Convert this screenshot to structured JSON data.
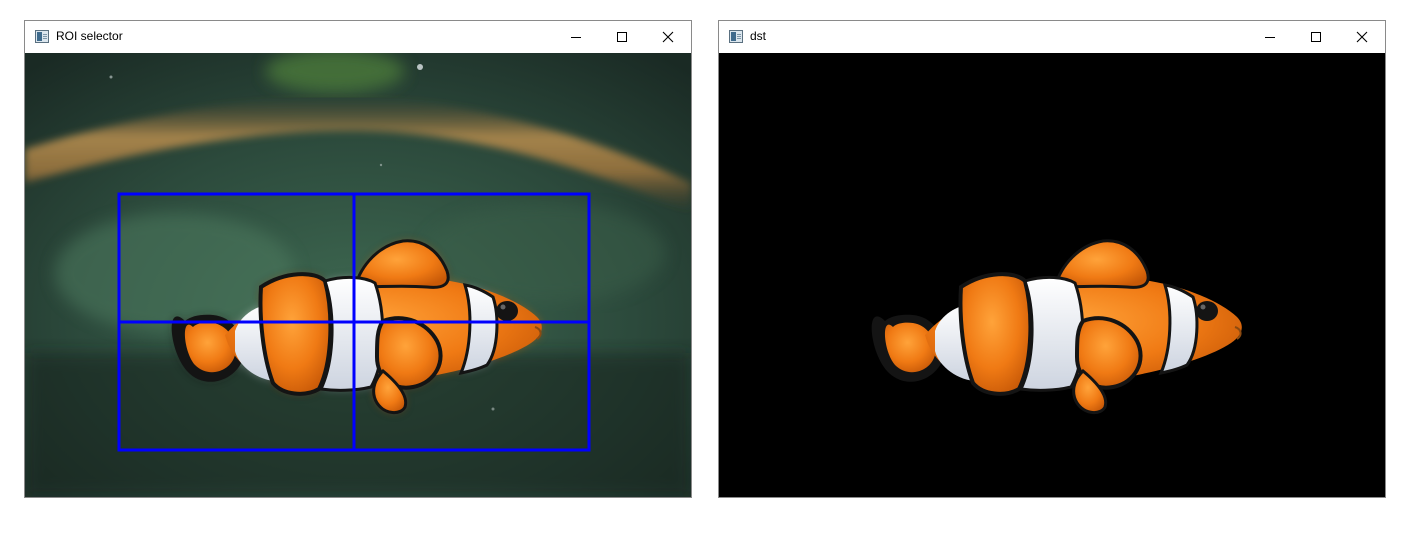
{
  "windows": [
    {
      "title": "ROI selector",
      "controls": {
        "minimize": "–",
        "maximize": "□",
        "close": "×"
      }
    },
    {
      "title": "dst",
      "controls": {
        "minimize": "–",
        "maximize": "□",
        "close": "×"
      }
    }
  ],
  "roi": {
    "rect_color": "#0000ff",
    "grid": "2x2"
  },
  "colors": {
    "fish_orange": "#f07a14",
    "fish_white": "#f2f4f8",
    "fish_black": "#141414",
    "water": "#2c4a3c",
    "rope": "#9a7a44",
    "mask_background": "#000000"
  }
}
